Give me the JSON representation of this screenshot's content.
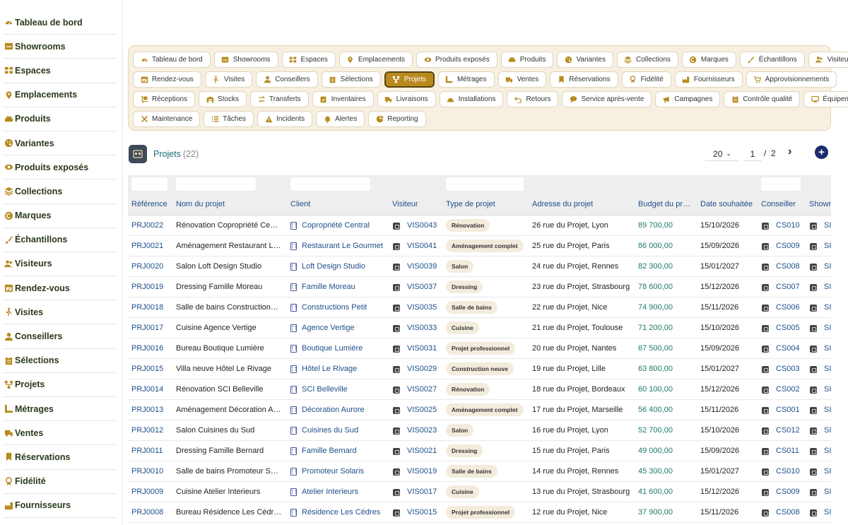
{
  "sidebar": {
    "items": [
      {
        "label": "Tableau de bord",
        "icon": "gauge-icon"
      },
      {
        "label": "Showrooms",
        "icon": "store-icon"
      },
      {
        "label": "Espaces",
        "icon": "grid-icon"
      },
      {
        "label": "Emplacements",
        "icon": "pin-icon"
      },
      {
        "label": "Produits",
        "icon": "sofa-icon"
      },
      {
        "label": "Variantes",
        "icon": "palette-icon"
      },
      {
        "label": "Produits exposés",
        "icon": "eye-icon"
      },
      {
        "label": "Collections",
        "icon": "layers-icon"
      },
      {
        "label": "Marques",
        "icon": "copyright-icon"
      },
      {
        "label": "Échantillons",
        "icon": "brush-icon"
      },
      {
        "label": "Visiteurs",
        "icon": "users-icon"
      },
      {
        "label": "Rendez-vous",
        "icon": "calendar-icon"
      },
      {
        "label": "Visites",
        "icon": "walk-icon"
      },
      {
        "label": "Conseillers",
        "icon": "user-tie-icon"
      },
      {
        "label": "Sélections",
        "icon": "clipboard-icon"
      },
      {
        "label": "Projets",
        "icon": "project-icon"
      },
      {
        "label": "Métrages",
        "icon": "ruler-icon"
      },
      {
        "label": "Ventes",
        "icon": "truck-icon"
      },
      {
        "label": "Réservations",
        "icon": "bookmark-icon"
      },
      {
        "label": "Fidélité",
        "icon": "award-icon"
      },
      {
        "label": "Fournisseurs",
        "icon": "factory-icon"
      }
    ]
  },
  "modules": {
    "rows": [
      [
        {
          "label": "Tableau de bord",
          "icon": "gauge-icon"
        },
        {
          "label": "Showrooms",
          "icon": "store-icon"
        },
        {
          "label": "Espaces",
          "icon": "grid-icon"
        },
        {
          "label": "Emplacements",
          "icon": "pin-icon"
        },
        {
          "label": "Produits exposés",
          "icon": "eye-icon"
        },
        {
          "label": "Produits",
          "icon": "sofa-icon"
        },
        {
          "label": "Variantes",
          "icon": "palette-icon"
        },
        {
          "label": "Collections",
          "icon": "layers-icon"
        },
        {
          "label": "Marques",
          "icon": "copyright-icon"
        },
        {
          "label": "Échantillons",
          "icon": "brush-icon"
        },
        {
          "label": "Visiteurs",
          "icon": "users-icon"
        }
      ],
      [
        {
          "label": "Rendez-vous",
          "icon": "calendar-icon"
        },
        {
          "label": "Visites",
          "icon": "walk-icon"
        },
        {
          "label": "Conseillers",
          "icon": "user-tie-icon"
        },
        {
          "label": "Sélections",
          "icon": "clipboard-icon"
        },
        {
          "label": "Projets",
          "icon": "project-icon",
          "active": true
        },
        {
          "label": "Métrages",
          "icon": "ruler-icon"
        },
        {
          "label": "Ventes",
          "icon": "truck-icon"
        },
        {
          "label": "Réservations",
          "icon": "bookmark-icon"
        },
        {
          "label": "Fidélité",
          "icon": "award-icon"
        },
        {
          "label": "Fournisseurs",
          "icon": "factory-icon"
        },
        {
          "label": "Approvisionnements",
          "icon": "cart-icon"
        }
      ],
      [
        {
          "label": "Réceptions",
          "icon": "dolly-icon"
        },
        {
          "label": "Stocks",
          "icon": "warehouse-icon"
        },
        {
          "label": "Transferts",
          "icon": "exchange-icon"
        },
        {
          "label": "Inventaires",
          "icon": "clipboard-check-icon"
        },
        {
          "label": "Livraisons",
          "icon": "truck-icon"
        },
        {
          "label": "Installations",
          "icon": "hardhat-icon"
        },
        {
          "label": "Retours",
          "icon": "undo-icon"
        },
        {
          "label": "Service après-vente",
          "icon": "chat-icon"
        },
        {
          "label": "Campagnes",
          "icon": "megaphone-icon"
        },
        {
          "label": "Contrôle qualité",
          "icon": "clipboard-icon"
        },
        {
          "label": "Équipements",
          "icon": "monitor-icon"
        }
      ],
      [
        {
          "label": "Maintenance",
          "icon": "tools-icon"
        },
        {
          "label": "Tâches",
          "icon": "list-icon"
        },
        {
          "label": "Incidents",
          "icon": "warning-icon"
        },
        {
          "label": "Alertes",
          "icon": "bell-icon"
        },
        {
          "label": "Reporting",
          "icon": "pie-icon"
        }
      ]
    ]
  },
  "list": {
    "title": "Projets",
    "count": "(22)",
    "page_size": "20",
    "page": "1",
    "separator": "/",
    "total_pages": "2",
    "next_glyph": "›",
    "add_glyph": "+"
  },
  "table": {
    "columns": [
      "Référence",
      "Nom du projet",
      "Client",
      "Visiteur",
      "Type de projet",
      "Adresse du projet",
      "Budget du pr…",
      "Date souhaitée",
      "Conseiller",
      "Showr"
    ],
    "rows": [
      {
        "ref": "PRJ0022",
        "name": "Rénovation Copropriété Ce…",
        "client": "Copropriété Central",
        "visitor": "VIS0043",
        "type": "Rénovation",
        "address": "26 rue du Projet, Lyon",
        "budget": "89 700,00",
        "date": "15/10/2026",
        "advisor": "CS010",
        "show": "SI"
      },
      {
        "ref": "PRJ0021",
        "name": "Aménagement Restaurant L…",
        "client": "Restaurant Le Gourmet",
        "visitor": "VIS0041",
        "type": "Aménagement complet",
        "address": "25 rue du Projet, Paris",
        "budget": "86 000,00",
        "date": "15/09/2026",
        "advisor": "CS009",
        "show": "SI"
      },
      {
        "ref": "PRJ0020",
        "name": "Salon Loft Design Studio",
        "client": "Loft Design Studio",
        "visitor": "VIS0039",
        "type": "Salon",
        "address": "24 rue du Projet, Rennes",
        "budget": "82 300,00",
        "date": "15/01/2027",
        "advisor": "CS008",
        "show": "SI"
      },
      {
        "ref": "PRJ0019",
        "name": "Dressing Famille Moreau",
        "client": "Famille Moreau",
        "visitor": "VIS0037",
        "type": "Dressing",
        "address": "23 rue du Projet, Strasbourg",
        "budget": "78 600,00",
        "date": "15/12/2026",
        "advisor": "CS007",
        "show": "SI"
      },
      {
        "ref": "PRJ0018",
        "name": "Salle de bains Construction…",
        "client": "Constructions Petit",
        "visitor": "VIS0035",
        "type": "Salle de bains",
        "address": "22 rue du Projet, Nice",
        "budget": "74 900,00",
        "date": "15/11/2026",
        "advisor": "CS006",
        "show": "SI"
      },
      {
        "ref": "PRJ0017",
        "name": "Cuisine Agence Vertige",
        "client": "Agence Vertige",
        "visitor": "VIS0033",
        "type": "Cuisine",
        "address": "21 rue du Projet, Toulouse",
        "budget": "71 200,00",
        "date": "15/10/2026",
        "advisor": "CS005",
        "show": "SI"
      },
      {
        "ref": "PRJ0016",
        "name": "Bureau Boutique Lumière",
        "client": "Boutique Lumière",
        "visitor": "VIS0031",
        "type": "Projet professionnel",
        "address": "20 rue du Projet, Nantes",
        "budget": "67 500,00",
        "date": "15/09/2026",
        "advisor": "CS004",
        "show": "SI"
      },
      {
        "ref": "PRJ0015",
        "name": "Villa neuve Hôtel Le Rivage",
        "client": "Hôtel Le Rivage",
        "visitor": "VIS0029",
        "type": "Construction neuve",
        "address": "19 rue du Projet, Lille",
        "budget": "63 800,00",
        "date": "15/01/2027",
        "advisor": "CS003",
        "show": "SI"
      },
      {
        "ref": "PRJ0014",
        "name": "Rénovation SCI Belleville",
        "client": "SCI Belleville",
        "visitor": "VIS0027",
        "type": "Rénovation",
        "address": "18 rue du Projet, Bordeaux",
        "budget": "60 100,00",
        "date": "15/12/2026",
        "advisor": "CS002",
        "show": "SI"
      },
      {
        "ref": "PRJ0013",
        "name": "Aménagement Décoration A…",
        "client": "Décoration Aurore",
        "visitor": "VIS0025",
        "type": "Aménagement complet",
        "address": "17 rue du Projet, Marseille",
        "budget": "56 400,00",
        "date": "15/11/2026",
        "advisor": "CS001",
        "show": "SI"
      },
      {
        "ref": "PRJ0012",
        "name": "Salon Cuisines du Sud",
        "client": "Cuisines du Sud",
        "visitor": "VIS0023",
        "type": "Salon",
        "address": "16 rue du Projet, Lyon",
        "budget": "52 700,00",
        "date": "15/10/2026",
        "advisor": "CS012",
        "show": "SI"
      },
      {
        "ref": "PRJ0011",
        "name": "Dressing Famille Bernard",
        "client": "Famille Bernard",
        "visitor": "VIS0021",
        "type": "Dressing",
        "address": "15 rue du Projet, Paris",
        "budget": "49 000,00",
        "date": "15/09/2026",
        "advisor": "CS011",
        "show": "SI"
      },
      {
        "ref": "PRJ0010",
        "name": "Salle de bains Promoteur S…",
        "client": "Promoteur Solaris",
        "visitor": "VIS0019",
        "type": "Salle de bains",
        "address": "14 rue du Projet, Rennes",
        "budget": "45 300,00",
        "date": "15/01/2027",
        "advisor": "CS010",
        "show": "SI"
      },
      {
        "ref": "PRJ0009",
        "name": "Cuisine Atelier Interieurs",
        "client": "Atelier Interieurs",
        "visitor": "VIS0017",
        "type": "Cuisine",
        "address": "13 rue du Projet, Strasbourg",
        "budget": "41 600,00",
        "date": "15/12/2026",
        "advisor": "CS009",
        "show": "SI"
      },
      {
        "ref": "PRJ0008",
        "name": "Bureau Résidence Les Cèdr…",
        "client": "Résidence Les Cèdres",
        "visitor": "VIS0015",
        "type": "Projet professionnel",
        "address": "12 rue du Projet, Nice",
        "budget": "37 900,00",
        "date": "15/11/2026",
        "advisor": "CS008",
        "show": "SI"
      }
    ]
  },
  "colors": {
    "accent": "#b88a1e",
    "sidebar_icon": "#b88a1e",
    "link": "#1e4f8a",
    "budget": "#1c7a6b",
    "panel_bg": "#f7f0e0",
    "add_button": "#1a2c6e"
  }
}
